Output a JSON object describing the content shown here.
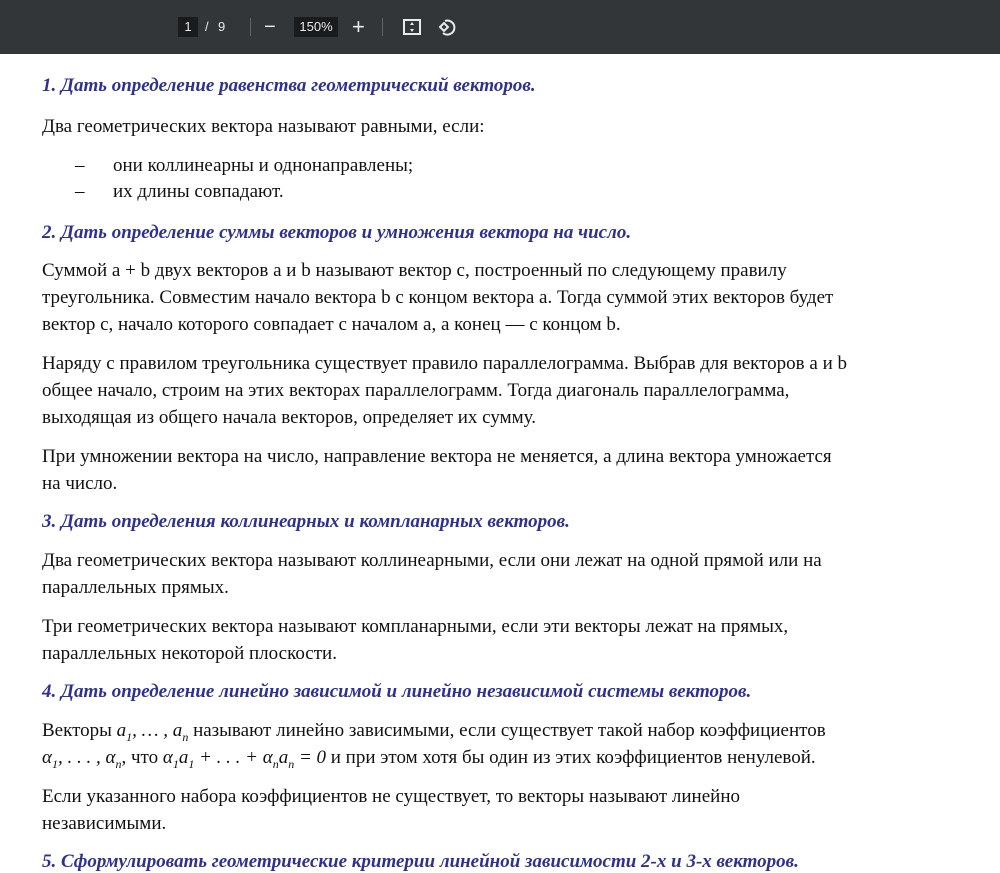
{
  "toolbar": {
    "page_current": "1",
    "page_sep": "/",
    "page_total": "9",
    "zoom_out": "−",
    "zoom_level": "150%",
    "zoom_in": "+"
  },
  "doc": {
    "h1": "1. Дать определение равенства геометрический векторов.",
    "p1": "Два геометрических вектора называют равными, если:",
    "list": [
      "они коллинеарны и однонаправлены;",
      "их длины совпадают."
    ],
    "list_marker": "–",
    "h2": "2. Дать определение суммы векторов и умножения вектора на число.",
    "p2": [
      "Суммой a + b двух векторов a и b называют вектор c, построенный по следующему правилу",
      "треугольника. Совместим начало вектора b с концом вектора a. Тогда суммой этих векторов будет",
      "вектор c, начало которого совпадает с началом a, а конец — с концом b."
    ],
    "p3": [
      "Наряду с правилом треугольника существует правило параллелограмма. Выбрав для векторов a и b",
      "общее начало, строим на этих векторах параллелограмм. Тогда диагональ параллелограмма,",
      "выходящая из общего начала векторов, определяет их сумму."
    ],
    "p4": [
      "При умножении вектора на число, направление вектора не меняется, а длина вектора умножается",
      "на число."
    ],
    "h3": "3. Дать определения коллинеарных и компланарных векторов.",
    "p5": [
      "Два геометрических вектора называют коллинеарными, если они лежат на одной прямой или на",
      "параллельных прямых."
    ],
    "p6": [
      "Три геометрических вектора называют компланарными, если эти векторы лежат на прямых,",
      "параллельных некоторой плоскости."
    ],
    "h4": "4. Дать определение линейно зависимой и линейно независимой системы векторов.",
    "p7": {
      "a": "Векторы ",
      "b": " называют линейно зависимыми, если существует такой набор коэффициентов",
      "c": ", что ",
      "d": " и при этом хотя бы один из этих коэффициентов ненулевой."
    },
    "p8": [
      "Если указанного набора коэффициентов не существует, то векторы называют линейно",
      "независимыми."
    ],
    "h5": "5. Сформулировать геометрические критерии линейной зависимости 2-х и 3-х векторов."
  }
}
